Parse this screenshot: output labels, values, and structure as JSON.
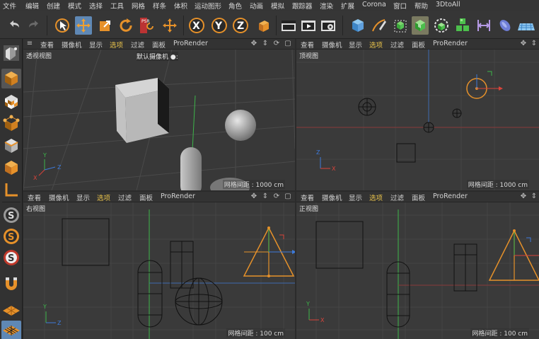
{
  "menu": [
    "文件",
    "编辑",
    "创建",
    "模式",
    "选择",
    "工具",
    "网格",
    "样条",
    "体积",
    "运动图形",
    "角色",
    "动画",
    "模拟",
    "跟踪器",
    "渲染",
    "扩展",
    "Corona",
    "窗口",
    "帮助",
    "3DtoAll"
  ],
  "toolbar": {
    "icons": [
      "undo-icon",
      "redo-icon",
      "select-tool-icon",
      "move-tool-icon",
      "scale-tool-icon",
      "rotate-tool-icon",
      "psr-icon",
      "transform-icon",
      "x-axis-lock-icon",
      "y-axis-lock-icon",
      "z-axis-lock-icon",
      "coordinate-system-icon",
      "render-region-icon",
      "render-view-icon",
      "render-settings-icon",
      "cube-object-icon",
      "pen-spline-icon",
      "subdivision-icon",
      "extrude-icon",
      "cloner-icon",
      "array-icon",
      "deformer-icon",
      "nurbs-icon",
      "floor-icon"
    ],
    "psr_text": "PSR",
    "axis_x": "X",
    "axis_y": "Y",
    "axis_z": "Z"
  },
  "left_palette": [
    "model-mode-icon",
    "object-mode-icon",
    "texture-mode-icon",
    "point-mode-icon",
    "edge-mode-icon",
    "polygon-mode-icon",
    "uv-mode-icon",
    "snap-icon",
    "snap-settings-icon",
    "snap-options-icon",
    "magnet-icon",
    "workplane-icon",
    "grid-icon"
  ],
  "viewport_menu": [
    "查看",
    "摄像机",
    "显示",
    "选项",
    "过滤",
    "面板",
    "ProRender"
  ],
  "viewports": [
    {
      "name": "透视视图",
      "grid": "网格间距 : 1000 cm",
      "camera": "默认摄像机",
      "camera_icon": "●:"
    },
    {
      "name": "顶视图",
      "grid": "网格间距 : 1000 cm"
    },
    {
      "name": "右视图",
      "grid": "网格间距 : 100 cm"
    },
    {
      "name": "正视图",
      "grid": "网格间距 : 100 cm"
    }
  ],
  "axis_labels": {
    "x": "X",
    "y": "Y",
    "z": "Z"
  },
  "colors": {
    "accent": "#5f88b5",
    "axis_x": "#d9443b",
    "axis_y": "#3db54a",
    "axis_z": "#3d7ad9",
    "selection": "#e6912a",
    "highlight_menu": "#e6c04a"
  }
}
